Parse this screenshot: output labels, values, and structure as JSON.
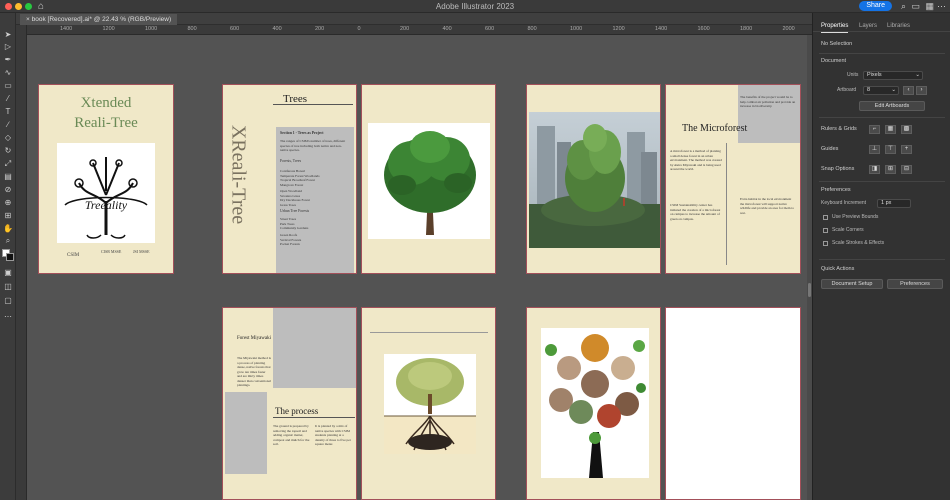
{
  "window": {
    "app_title": "Adobe Illustrator 2023",
    "share_label": "Share"
  },
  "document_tab": {
    "label": "book [Recovered].ai* @ 22.43 % (RGB/Preview)"
  },
  "ruler": {
    "ticks": [
      "1400",
      "1200",
      "1000",
      "800",
      "600",
      "400",
      "200",
      "0",
      "200",
      "400",
      "600",
      "800",
      "1000",
      "1200",
      "1400",
      "1600",
      "1800",
      "2000"
    ]
  },
  "artboards": {
    "cover": {
      "title_line1": "Xtended",
      "title_line2": "Reali-Tree",
      "logo_text": "Treeality",
      "footer_left": "CSIM",
      "footer_mid": "CISR MSSE",
      "footer_right": "JSI MSSE"
    },
    "trees": {
      "heading": "Trees",
      "vertical_title": "XReali-Tree",
      "section_heading": "Section 1 - Trees as Project",
      "para_intro": "The ranges of CSIM's number of trees, different species of tree including both native and non-native species.",
      "subhead_forest": "Forests, Trees",
      "list_a": "Coniferous Boreal\nTemperate Forest Woodlands\nTropical Broadleaf Forest\nMangrove Forest",
      "list_b": "Open Woodland\nSavanna Grass\nDry Deciduous Forest\nGrass Trees",
      "subhead_urban": "Urban Tree Forests",
      "list_c": "Street Trees\nPark Trees\nCommunity Gardens",
      "list_d": "Green Roofs\nVertical Forests\nPocket Forests"
    },
    "microforest": {
      "heading": "The Microforest",
      "para_left": "A microforest is a method of planting a small dense forest in an urban environment. The method was created by Akira Miyawaki and is being used around the world.",
      "para_left_2": "CSIM Sustainability center has initiated the creation of a microforest on campus to increase the amount of green on campus.",
      "para_right_top": "The benefits of the project would be to help combat air pollution and provide an increase in biodiversity.",
      "para_right_bottom": "Extra habitat in the local environment the microforest will support native wildlife and provide an area for them to rest."
    },
    "miyawaki": {
      "heading": "Forest Miyawaki",
      "para": "The Miyawaki method is a process of planting dense, native forests that grow ten times faster and are thirty times denser than conventional plantings.",
      "process_heading": "The process",
      "para_left": "The ground is prepared by removing the topsoil and adding organic matter, compost and mulch for the soil.",
      "para_right": "It is planted by a mix of native species with CSIM students planting at a density of three to five per square meter."
    }
  },
  "panel": {
    "tabs": [
      "Properties",
      "Layers",
      "Libraries"
    ],
    "no_selection": "No Selection",
    "document_heading": "Document",
    "units_label": "Units",
    "units_value": "Pixels",
    "artboard_label": "Artboard",
    "artboard_value": "8",
    "edit_artboards": "Edit Artboards",
    "rulers_grids": "Rulers & Grids",
    "guides": "Guides",
    "snap_options": "Snap Options",
    "preferences_heading": "Preferences",
    "keyboard_increment_label": "Keyboard Increment",
    "keyboard_increment_value": "1 px",
    "use_preview_bounds": "Use Preview Bounds",
    "scale_corners": "Scale Corners",
    "scale_strokes": "Scale Strokes & Effects",
    "quick_actions": "Quick Actions",
    "document_setup": "Document Setup",
    "preferences_button": "Preferences"
  }
}
